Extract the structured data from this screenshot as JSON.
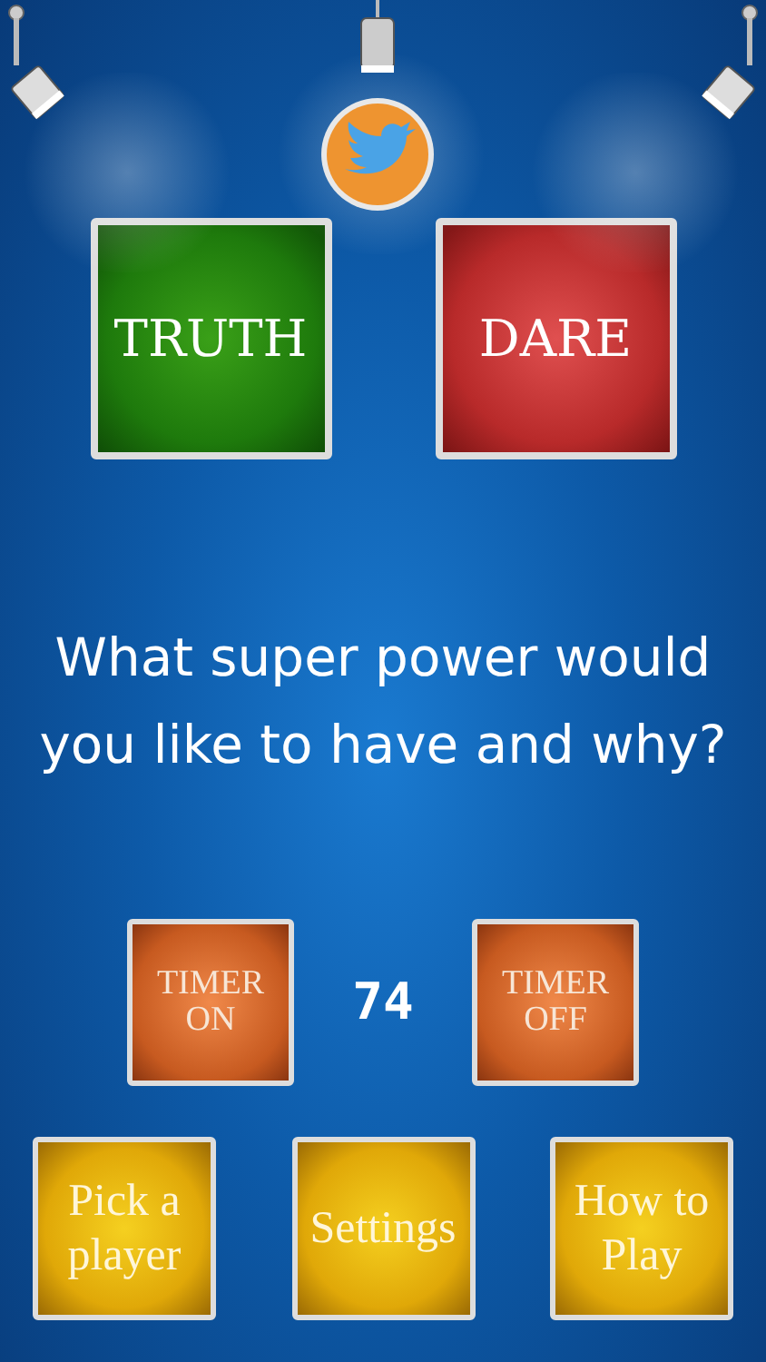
{
  "choice_buttons": [
    {
      "label": "TRUTH",
      "kind": "truth"
    },
    {
      "label": "DARE",
      "kind": "dare"
    }
  ],
  "question": "What super power would you like to have and why?",
  "timer": {
    "on_label": "TIMER ON",
    "value": "74",
    "off_label": "TIMER OFF"
  },
  "menu_buttons": [
    {
      "label": "Pick a player"
    },
    {
      "label": "Settings"
    },
    {
      "label": "How to Play"
    }
  ]
}
